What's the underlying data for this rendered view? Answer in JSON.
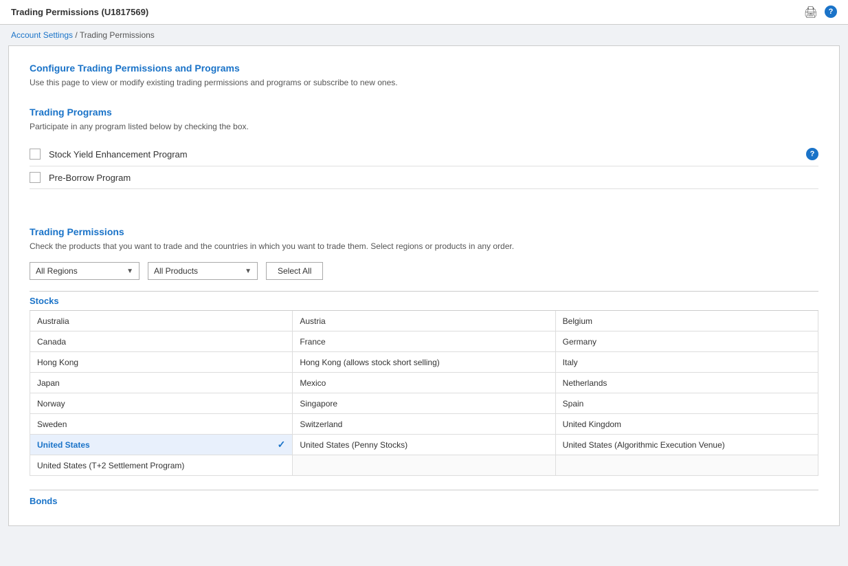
{
  "header": {
    "title": "Trading Permissions   (U1817569)",
    "print_icon": "🖨",
    "help_icon": "?"
  },
  "breadcrumb": {
    "account_settings_label": "Account Settings",
    "separator": " / ",
    "current": "Trading Permissions"
  },
  "configure_section": {
    "title": "Configure Trading Permissions and Programs",
    "description": "Use this page to view or modify existing trading permissions and programs or subscribe to new ones."
  },
  "trading_programs": {
    "title": "Trading Programs",
    "description": "Participate in any program listed below by checking the box.",
    "programs": [
      {
        "id": "syep",
        "label": "Stock Yield Enhancement Program",
        "checked": false,
        "has_help": true
      },
      {
        "id": "pbp",
        "label": "Pre-Borrow Program",
        "checked": false,
        "has_help": false
      }
    ]
  },
  "trading_permissions": {
    "title": "Trading Permissions",
    "description": "Check the products that you want to trade and the countries in which you want to trade them. Select regions or products in any order.",
    "regions_label": "All Regions",
    "products_label": "All Products",
    "select_all_label": "Select All",
    "stocks_title": "Stocks",
    "countries": [
      {
        "name": "Australia",
        "selected": false,
        "col": 0
      },
      {
        "name": "Austria",
        "selected": false,
        "col": 1
      },
      {
        "name": "Belgium",
        "selected": false,
        "col": 2
      },
      {
        "name": "Canada",
        "selected": false,
        "col": 0
      },
      {
        "name": "France",
        "selected": false,
        "col": 1
      },
      {
        "name": "Germany",
        "selected": false,
        "col": 2
      },
      {
        "name": "Hong Kong",
        "selected": false,
        "col": 0
      },
      {
        "name": "Hong Kong (allows stock short selling)",
        "selected": false,
        "col": 1
      },
      {
        "name": "Italy",
        "selected": false,
        "col": 2
      },
      {
        "name": "Japan",
        "selected": false,
        "col": 0
      },
      {
        "name": "Mexico",
        "selected": false,
        "col": 1
      },
      {
        "name": "Netherlands",
        "selected": false,
        "col": 2
      },
      {
        "name": "Norway",
        "selected": false,
        "col": 0
      },
      {
        "name": "Singapore",
        "selected": false,
        "col": 1
      },
      {
        "name": "Spain",
        "selected": false,
        "col": 2
      },
      {
        "name": "Sweden",
        "selected": false,
        "col": 0
      },
      {
        "name": "Switzerland",
        "selected": false,
        "col": 1
      },
      {
        "name": "United Kingdom",
        "selected": false,
        "col": 2
      },
      {
        "name": "United States",
        "selected": true,
        "col": 0
      },
      {
        "name": "United States (Penny Stocks)",
        "selected": false,
        "col": 1
      },
      {
        "name": "United States (Algorithmic Execution Venue)",
        "selected": false,
        "col": 2
      },
      {
        "name": "United States (T+2 Settlement Program)",
        "selected": false,
        "col": 0
      }
    ],
    "bonds_title": "Bonds"
  }
}
